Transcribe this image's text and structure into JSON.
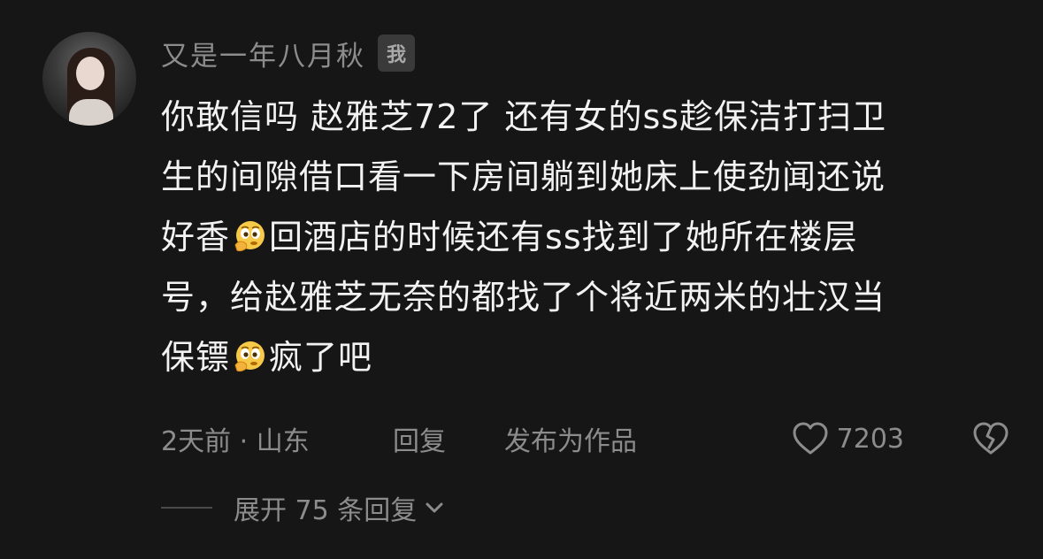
{
  "comment": {
    "username": "又是一年八月秋",
    "author_badge": "我",
    "lines": [
      [
        "你敢信吗 赵雅芝72了 还有女的ss趁保洁打扫卫"
      ],
      [
        "生的间隙借口看一下房间躺到她床上使劲闻还说"
      ],
      [
        "好香",
        "回酒店的时候还有ss找到了她所在楼层"
      ],
      [
        "号，给赵雅芝无奈的都找了个将近两米的壮汉当"
      ],
      [
        "保镖",
        "疯了吧"
      ]
    ],
    "emoji_icon": "thinking-face-emoji",
    "time_location": "2天前 · 山东",
    "reply_label": "回复",
    "publish_label": "发布为作品",
    "like_count": "7203",
    "expand_label": "展开 75 条回复"
  },
  "colors": {
    "background": "#161616",
    "primary_text": "#f2f2f2",
    "secondary_text": "#8c8c8c"
  }
}
